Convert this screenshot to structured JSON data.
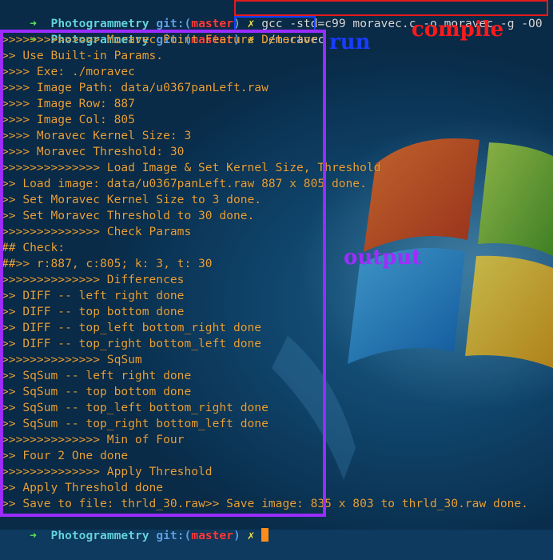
{
  "prompt": {
    "arrow": "➜",
    "dir": "Photogrammetry",
    "git_prefix": "git:(",
    "branch": "master",
    "git_suffix": ")",
    "dirty_mark": "✗"
  },
  "commands": {
    "compile": "gcc -std=c99 moravec.c -o moravec -g -O0",
    "run": "./moravec"
  },
  "annotations": {
    "compile": "compile",
    "run": "run",
    "output": "output"
  },
  "output_lines": [
    ">>>>>>>>>>>>>> Moravec Point Feature Detector",
    ">> Use Built-in Params.",
    ">>>> Exe: ./moravec",
    ">>>> Image Path: data/u0367panLeft.raw",
    ">>>> Image Row: 887",
    ">>>> Image Col: 805",
    ">>>> Moravec Kernel Size: 3",
    ">>>> Moravec Threshold: 30",
    ">>>>>>>>>>>>>> Load Image & Set Kernel Size, Threshold",
    ">> Load image: data/u0367panLeft.raw 887 x 805 done.",
    ">> Set Moravec Kernel Size to 3 done.",
    ">> Set Moravec Threshold to 30 done.",
    ">>>>>>>>>>>>>> Check Params",
    "## Check:",
    "##>> r:887, c:805; k: 3, t: 30",
    ">>>>>>>>>>>>>> Differences",
    ">> DIFF -- left right done",
    ">> DIFF -- top bottom done",
    ">> DIFF -- top_left bottom_right done",
    ">> DIFF -- top_right bottom_left done",
    ">>>>>>>>>>>>>> SqSum",
    ">> SqSum -- left right done",
    ">> SqSum -- top bottom done",
    ">> SqSum -- top_left bottom_right done",
    ">> SqSum -- top_right bottom_left done",
    ">>>>>>>>>>>>>> Min of Four",
    ">> Four 2 One done",
    ">>>>>>>>>>>>>> Apply Threshold",
    ">> Apply Threshold done",
    ">> Save to file: thrld_30.raw>> Save image: 835 x 803 to thrld_30.raw done."
  ],
  "colors": {
    "output_text": "#e8a23c",
    "compile_box": "#e21b1b",
    "run_box": "#1740ff",
    "output_box": "#9a2cff",
    "cursor": "#ff8c1a"
  }
}
